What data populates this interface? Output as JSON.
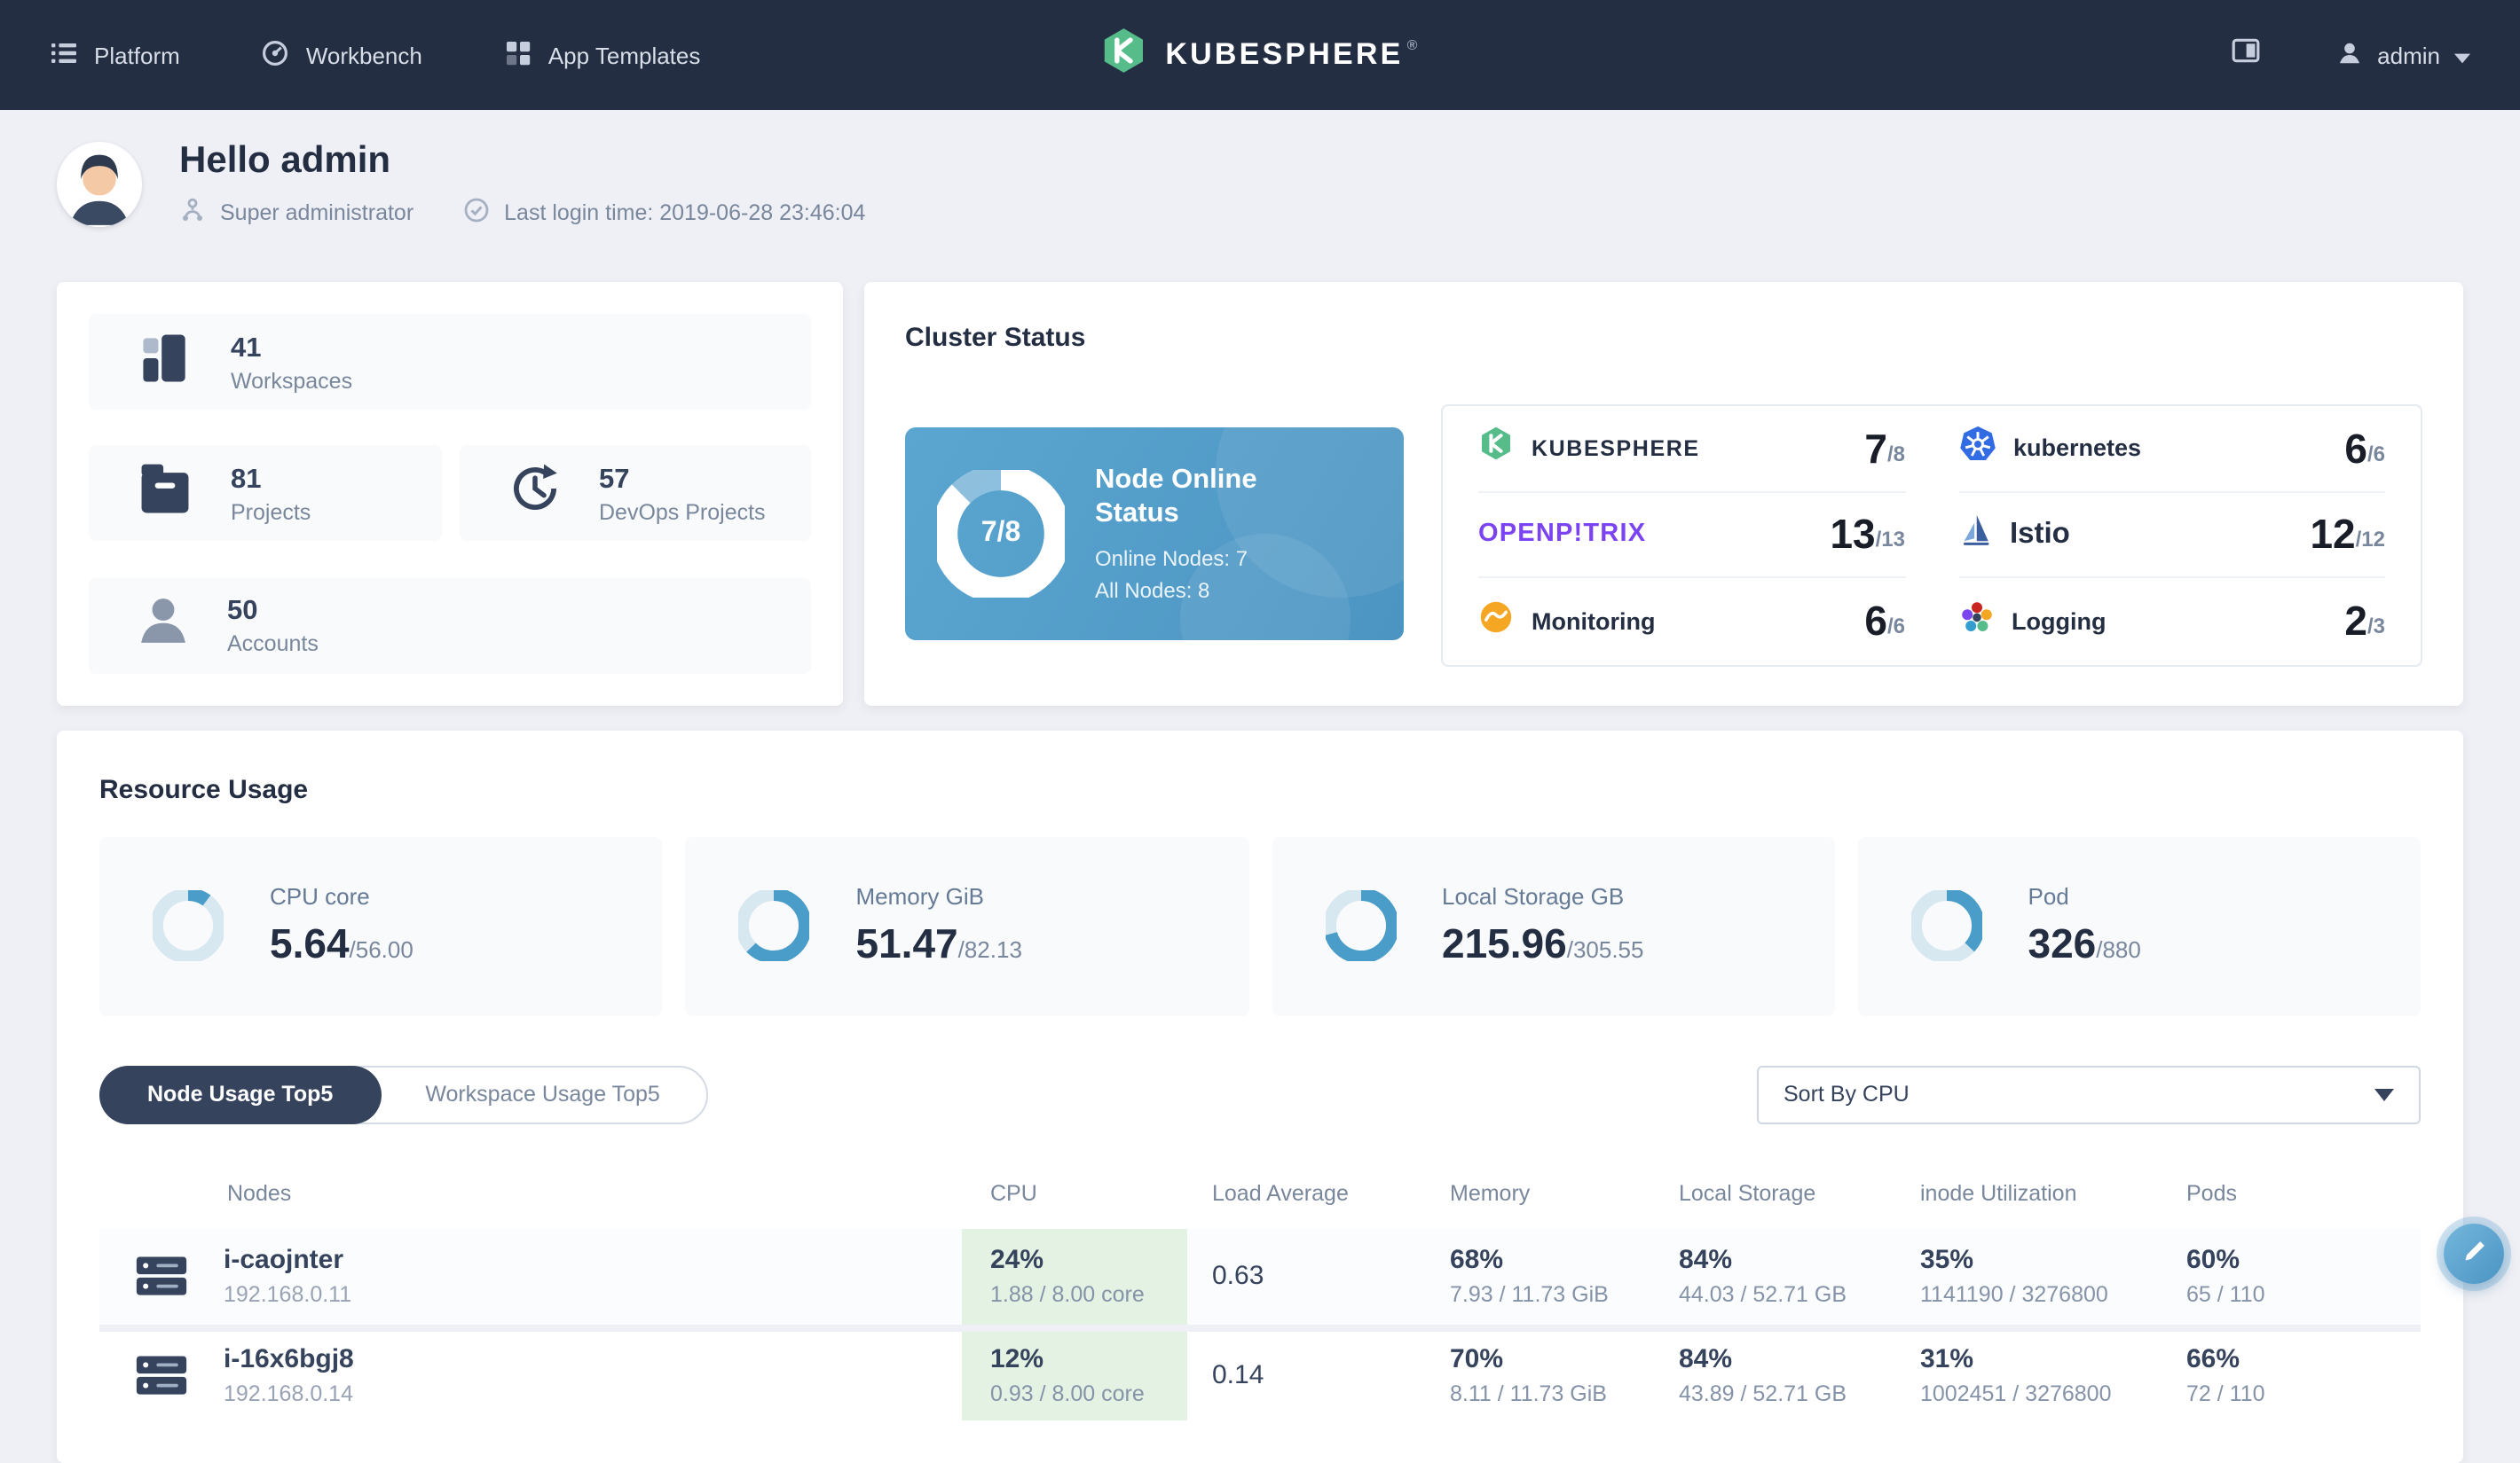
{
  "nav": {
    "items": [
      {
        "label": "Platform",
        "icon": "platform-icon"
      },
      {
        "label": "Workbench",
        "icon": "workbench-icon"
      },
      {
        "label": "App Templates",
        "icon": "app-templates-icon"
      }
    ],
    "brand": {
      "text": "KUBESPHERE",
      "reg": "®",
      "icon": "kubesphere-logo"
    },
    "user": {
      "name": "admin",
      "icon": "user-icon"
    }
  },
  "header": {
    "greeting": "Hello admin",
    "role": "Super administrator",
    "last_login": "Last login time: 2019-06-28 23:46:04"
  },
  "stats": [
    {
      "value": "41",
      "label": "Workspaces",
      "icon": "workspaces-icon"
    },
    {
      "value": "81",
      "label": "Projects",
      "icon": "projects-icon"
    },
    {
      "value": "57",
      "label": "DevOps Projects",
      "icon": "devops-icon"
    },
    {
      "value": "50",
      "label": "Accounts",
      "icon": "accounts-icon"
    }
  ],
  "cluster": {
    "title": "Cluster Status",
    "panel": {
      "value": "7/8",
      "fraction": 0.875,
      "title": "Node Online Status",
      "online": "Online Nodes: 7",
      "all": "All Nodes: 8"
    },
    "components": [
      {
        "name": "KUBESPHERE",
        "value": "7",
        "denom": "/8",
        "icon": "kubesphere-logo"
      },
      {
        "name": "kubernetes",
        "value": "6",
        "denom": "/6",
        "icon": "kubernetes-logo"
      },
      {
        "name": "OPENP!TRIX",
        "value": "13",
        "denom": "/13",
        "icon": "openpitrix-logo"
      },
      {
        "name": "Istio",
        "value": "12",
        "denom": "/12",
        "icon": "istio-logo"
      },
      {
        "name": "Monitoring",
        "value": "6",
        "denom": "/6",
        "icon": "monitoring-icon"
      },
      {
        "name": "Logging",
        "value": "2",
        "denom": "/3",
        "icon": "logging-icon"
      }
    ]
  },
  "resource": {
    "title": "Resource Usage",
    "metrics": [
      {
        "label": "CPU core",
        "value": "5.64",
        "denom": "/56.00",
        "fraction": 0.101
      },
      {
        "label": "Memory GiB",
        "value": "51.47",
        "denom": "/82.13",
        "fraction": 0.627
      },
      {
        "label": "Local Storage GB",
        "value": "215.96",
        "denom": "/305.55",
        "fraction": 0.707
      },
      {
        "label": "Pod",
        "value": "326",
        "denom": "/880",
        "fraction": 0.37
      }
    ],
    "tabs": [
      {
        "label": "Node Usage Top5"
      },
      {
        "label": "Workspace Usage Top5"
      }
    ],
    "sort_label": "Sort By CPU",
    "table": {
      "headers": [
        "Nodes",
        "CPU",
        "Load Average",
        "Memory",
        "Local Storage",
        "inode Utilization",
        "Pods"
      ],
      "rows": [
        {
          "node": "i-caojnter",
          "ip": "192.168.0.11",
          "cpu_pct": "24%",
          "cpu_detail": "1.88 / 8.00 core",
          "load": "0.63",
          "mem_pct": "68%",
          "mem_detail": "7.93 / 11.73 GiB",
          "storage_pct": "84%",
          "storage_detail": "44.03 / 52.71 GB",
          "inode_pct": "35%",
          "inode_detail": "1141190 / 3276800",
          "pods_pct": "60%",
          "pods_detail": "65 / 110"
        },
        {
          "node": "i-16x6bgj8",
          "ip": "192.168.0.14",
          "cpu_pct": "12%",
          "cpu_detail": "0.93 / 8.00 core",
          "load": "0.14",
          "mem_pct": "70%",
          "mem_detail": "8.11 / 11.73 GiB",
          "storage_pct": "84%",
          "storage_detail": "43.89 / 52.71 GB",
          "inode_pct": "31%",
          "inode_detail": "1002451 / 3276800",
          "pods_pct": "66%",
          "pods_detail": "72 / 110"
        }
      ]
    }
  },
  "colors": {
    "nav_bg": "#242e42",
    "brand_green": "#55bc8a",
    "panel_blue": "#4c94c2",
    "accent_blue": "#4a9dc8",
    "green_cell": "#e4f2e4",
    "page_bg": "#eff0f5",
    "text_dark": "#242e42",
    "text_gray": "#79879c"
  }
}
